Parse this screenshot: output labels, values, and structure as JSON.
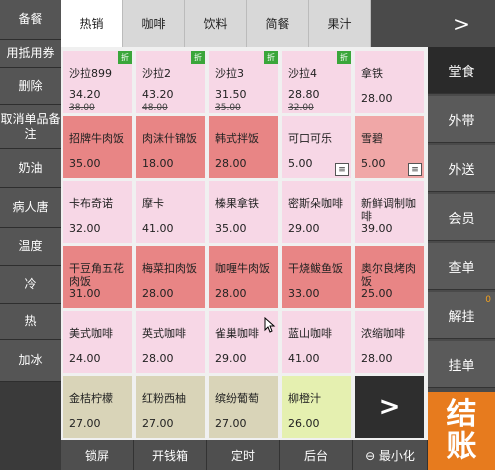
{
  "left_panel": [
    "备餐",
    "用抵用券",
    "删除",
    "取消单品备注",
    "奶油",
    "病人唐",
    "温度",
    "冷",
    "热",
    "加冰"
  ],
  "tabs": [
    "热销",
    "咖啡",
    "饮料",
    "简餐",
    "果汁"
  ],
  "tab_next": ">",
  "items": [
    {
      "name": "沙拉899",
      "price": "34.20",
      "orig": "38.00",
      "color": "#f7d7e6",
      "discount": "折"
    },
    {
      "name": "沙拉2",
      "price": "43.20",
      "orig": "48.00",
      "color": "#f7d7e6",
      "discount": "折"
    },
    {
      "name": "沙拉3",
      "price": "31.50",
      "orig": "35.00",
      "color": "#f7d7e6",
      "discount": "折"
    },
    {
      "name": "沙拉4",
      "price": "28.80",
      "orig": "32.00",
      "color": "#f7d7e6",
      "discount": "折"
    },
    {
      "name": "拿铁",
      "price": "28.00",
      "color": "#f7d7e6"
    },
    {
      "name": "招牌牛肉饭",
      "price": "35.00",
      "color": "#e88585"
    },
    {
      "name": "肉沫什锦饭",
      "price": "18.00",
      "color": "#e88585"
    },
    {
      "name": "韩式拌饭",
      "price": "28.00",
      "color": "#e88585"
    },
    {
      "name": "可口可乐",
      "price": "5.00",
      "color": "#f7d7e6",
      "menu": "≡"
    },
    {
      "name": "雪碧",
      "price": "5.00",
      "color": "#f0a7a7",
      "menu": "≡"
    },
    {
      "name": "卡布奇诺",
      "price": "32.00",
      "color": "#f7d7e6"
    },
    {
      "name": "摩卡",
      "price": "41.00",
      "color": "#f7d7e6"
    },
    {
      "name": "榛果拿铁",
      "price": "35.00",
      "color": "#f7d7e6"
    },
    {
      "name": "密斯朵咖啡",
      "price": "29.00",
      "color": "#f7d7e6"
    },
    {
      "name": "新鲜调制咖啡",
      "price": "39.00",
      "color": "#f7d7e6"
    },
    {
      "name": "干豆角五花肉饭",
      "price": "31.00",
      "color": "#e88585"
    },
    {
      "name": "梅菜扣肉饭",
      "price": "28.00",
      "color": "#e88585"
    },
    {
      "name": "咖喱牛肉饭",
      "price": "28.00",
      "color": "#e88585"
    },
    {
      "name": "干烧鲅鱼饭",
      "price": "33.00",
      "color": "#e88585"
    },
    {
      "name": "奥尔良烤肉饭",
      "price": "25.00",
      "color": "#e88585"
    },
    {
      "name": "美式咖啡",
      "price": "24.00",
      "color": "#f7d7e6"
    },
    {
      "name": "英式咖啡",
      "price": "28.00",
      "color": "#f7d7e6"
    },
    {
      "name": "雀巢咖啡",
      "price": "29.00",
      "color": "#f7d7e6"
    },
    {
      "name": "蓝山咖啡",
      "price": "41.00",
      "color": "#f7d7e6"
    },
    {
      "name": "浓缩咖啡",
      "price": "28.00",
      "color": "#f7d7e6"
    },
    {
      "name": "金桔柠檬",
      "price": "27.00",
      "color": "#d9d4b8"
    },
    {
      "name": "红粉西柚",
      "price": "27.00",
      "color": "#d9d4b8"
    },
    {
      "name": "缤纷葡萄",
      "price": "27.00",
      "color": "#d9d4b8"
    },
    {
      "name": "柳橙汁",
      "price": "26.00",
      "color": "#e5f0b0"
    }
  ],
  "grid_next": ">",
  "right_panel": [
    {
      "label": "堂食",
      "active": true
    },
    {
      "label": "外带"
    },
    {
      "label": "外送"
    },
    {
      "label": "会员"
    },
    {
      "label": "查单"
    },
    {
      "label": "解挂",
      "badge": "0"
    },
    {
      "label": "挂单"
    }
  ],
  "checkout": "结账",
  "bottom": [
    "锁屏",
    "开钱箱",
    "定时",
    "后台",
    "⊖ 最小化"
  ]
}
